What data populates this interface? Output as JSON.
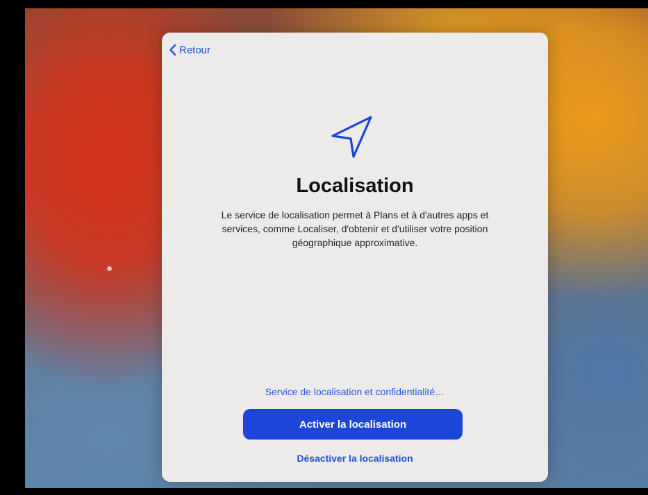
{
  "nav": {
    "back_label": "Retour",
    "back_icon": "chevron-left-icon"
  },
  "hero": {
    "icon": "location-arrow-icon"
  },
  "content": {
    "title": "Localisation",
    "description": "Le service de localisation permet à Plans et à d'autres apps et services, comme Localiser, d'obtenir et d'utiliser votre position géographique approximative."
  },
  "actions": {
    "privacy_link": "Service de localisation et confidentialité…",
    "enable_label": "Activer la localisation",
    "disable_label": "Désactiver la localisation"
  },
  "colors": {
    "accent": "#1d46d9",
    "link": "#2456d4",
    "card": "#ecebea"
  }
}
